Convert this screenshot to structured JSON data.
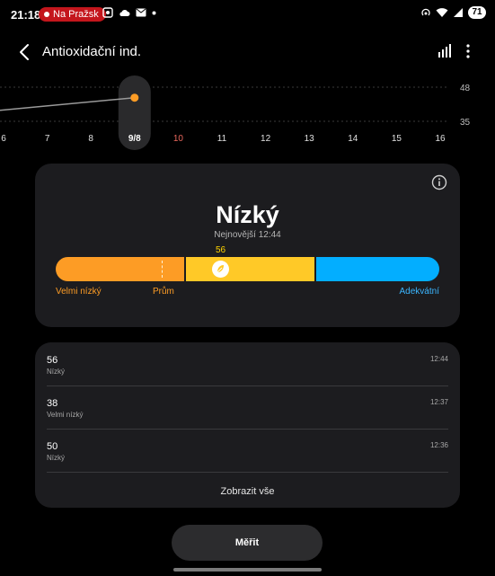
{
  "status_bar": {
    "time": "21:18",
    "pill_text": "Na Pražsk",
    "battery": "71"
  },
  "header": {
    "title": "Antioxidační ind.",
    "back_icon": "chevron-left-icon",
    "chart_icon": "bar-chart-icon",
    "more_icon": "more-vertical-icon"
  },
  "chart_data": {
    "type": "line",
    "x_ticks": [
      "6",
      "7",
      "8",
      "9/8",
      "10",
      "11",
      "12",
      "13",
      "14",
      "15",
      "16"
    ],
    "selected_tick": "9/8",
    "highlighted_tick": "10",
    "y_ticks": [
      "48",
      "35"
    ],
    "series": [
      {
        "x": [
          "9/8"
        ],
        "values": [
          44
        ]
      }
    ],
    "grid": true,
    "colors": {
      "point": "#fd9c25",
      "line": "#9a9a9a",
      "highlight": "#e8675c"
    }
  },
  "summary": {
    "level": "Nízký",
    "latest": "Nejnovější 12:44",
    "current_value": "56",
    "current_fraction": 0.43,
    "labels": {
      "very_low": "Velmi nízký",
      "average": "Prům",
      "adequate": "Adekvátní"
    },
    "colors": {
      "very_low": "#fd9c25",
      "low": "#ffc927",
      "adequate": "#03aeff"
    },
    "info_icon": "info-circle-icon",
    "marker_icon": "leaf-icon"
  },
  "history": {
    "rows": [
      {
        "value": "56",
        "level": "Nízký",
        "time": "12:44"
      },
      {
        "value": "38",
        "level": "Velmi nízký",
        "time": "12:37"
      },
      {
        "value": "50",
        "level": "Nízký",
        "time": "12:36"
      }
    ],
    "show_all": "Zobrazit vše"
  },
  "measure_button": "Měřit"
}
